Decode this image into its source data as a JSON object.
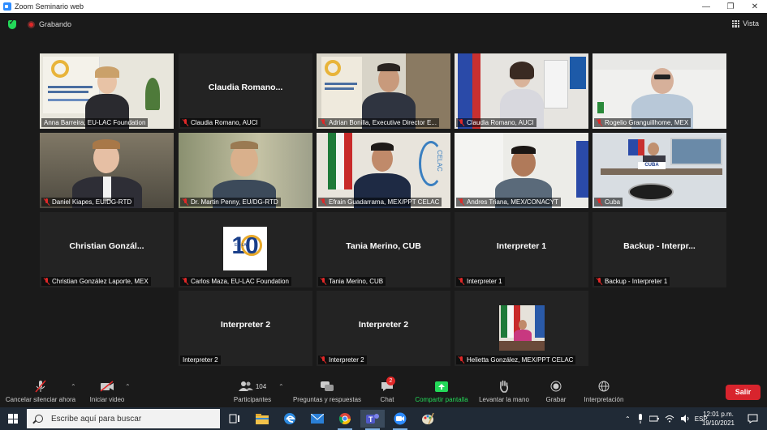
{
  "window": {
    "title": "Zoom Seminario web",
    "minimize": "—",
    "restore": "❐",
    "close": "✕"
  },
  "meeting": {
    "recording_label": "Grabando",
    "view_label": "Vista"
  },
  "tiles": [
    {
      "name": "Anna Barreira, EU-LAC Foundation",
      "big": ""
    },
    {
      "name": "Claudia Romano, AUCI",
      "big": "Claudia  Romano..."
    },
    {
      "name": "Adrian Bonilla, Executive Director E...",
      "big": ""
    },
    {
      "name": "Claudia Romano, AUCI",
      "big": ""
    },
    {
      "name": "Rogelio Granguillhome, MEX",
      "big": ""
    },
    {
      "name": "Daniel Kiapes, EU/DG-RTD",
      "big": ""
    },
    {
      "name": "Dr. Martin Penny, EU/DG-RTD",
      "big": ""
    },
    {
      "name": "Efrain Guadarrama, MEX/PPT CELAC",
      "big": ""
    },
    {
      "name": "Andres Triana, MEX/CONACYT",
      "big": ""
    },
    {
      "name": "Cuba",
      "big": ""
    },
    {
      "name": "Christian González Laporte, MEX",
      "big": "Christian  Gonzál..."
    },
    {
      "name": "Carlos Maza, EU-LAC Foundation",
      "big": ""
    },
    {
      "name": "Tania Merino, CUB",
      "big": "Tania Merino, CUB"
    },
    {
      "name": "Interpreter 1",
      "big": "Interpreter 1"
    },
    {
      "name": "Backup - Interpreter 1",
      "big": "Backup  -  Interpr..."
    },
    {
      "name": "Interpreter 2",
      "big": "Interpreter 2"
    },
    {
      "name": "Interpreter 2",
      "big": "Interpreter 2"
    },
    {
      "name": "Helietta González, MEX/PPT CELAC",
      "big": ""
    }
  ],
  "tile_text": {
    "celac": "CELAC",
    "cuba_sign": "CUBA",
    "eulac_logo_ten": "10",
    "eulac_logo_text": "EU-LAC"
  },
  "toolbar": {
    "mute": "Cancelar silenciar ahora",
    "video": "Iniciar video",
    "participants": "Participantes",
    "participants_count": "104",
    "polls": "Preguntas y respuestas",
    "chat": "Chat",
    "chat_badge": "2",
    "share": "Compartir pantalla",
    "raise_hand": "Levantar la mano",
    "record": "Grabar",
    "interpretation": "Interpretación",
    "leave": "Salir",
    "share_color": "#23d959",
    "leave_color": "#d8242d"
  },
  "taskbar": {
    "search_placeholder": "Escribe aquí para buscar",
    "lang": "ESP",
    "time": "12:01 p.m.",
    "date": "19/10/2021"
  }
}
